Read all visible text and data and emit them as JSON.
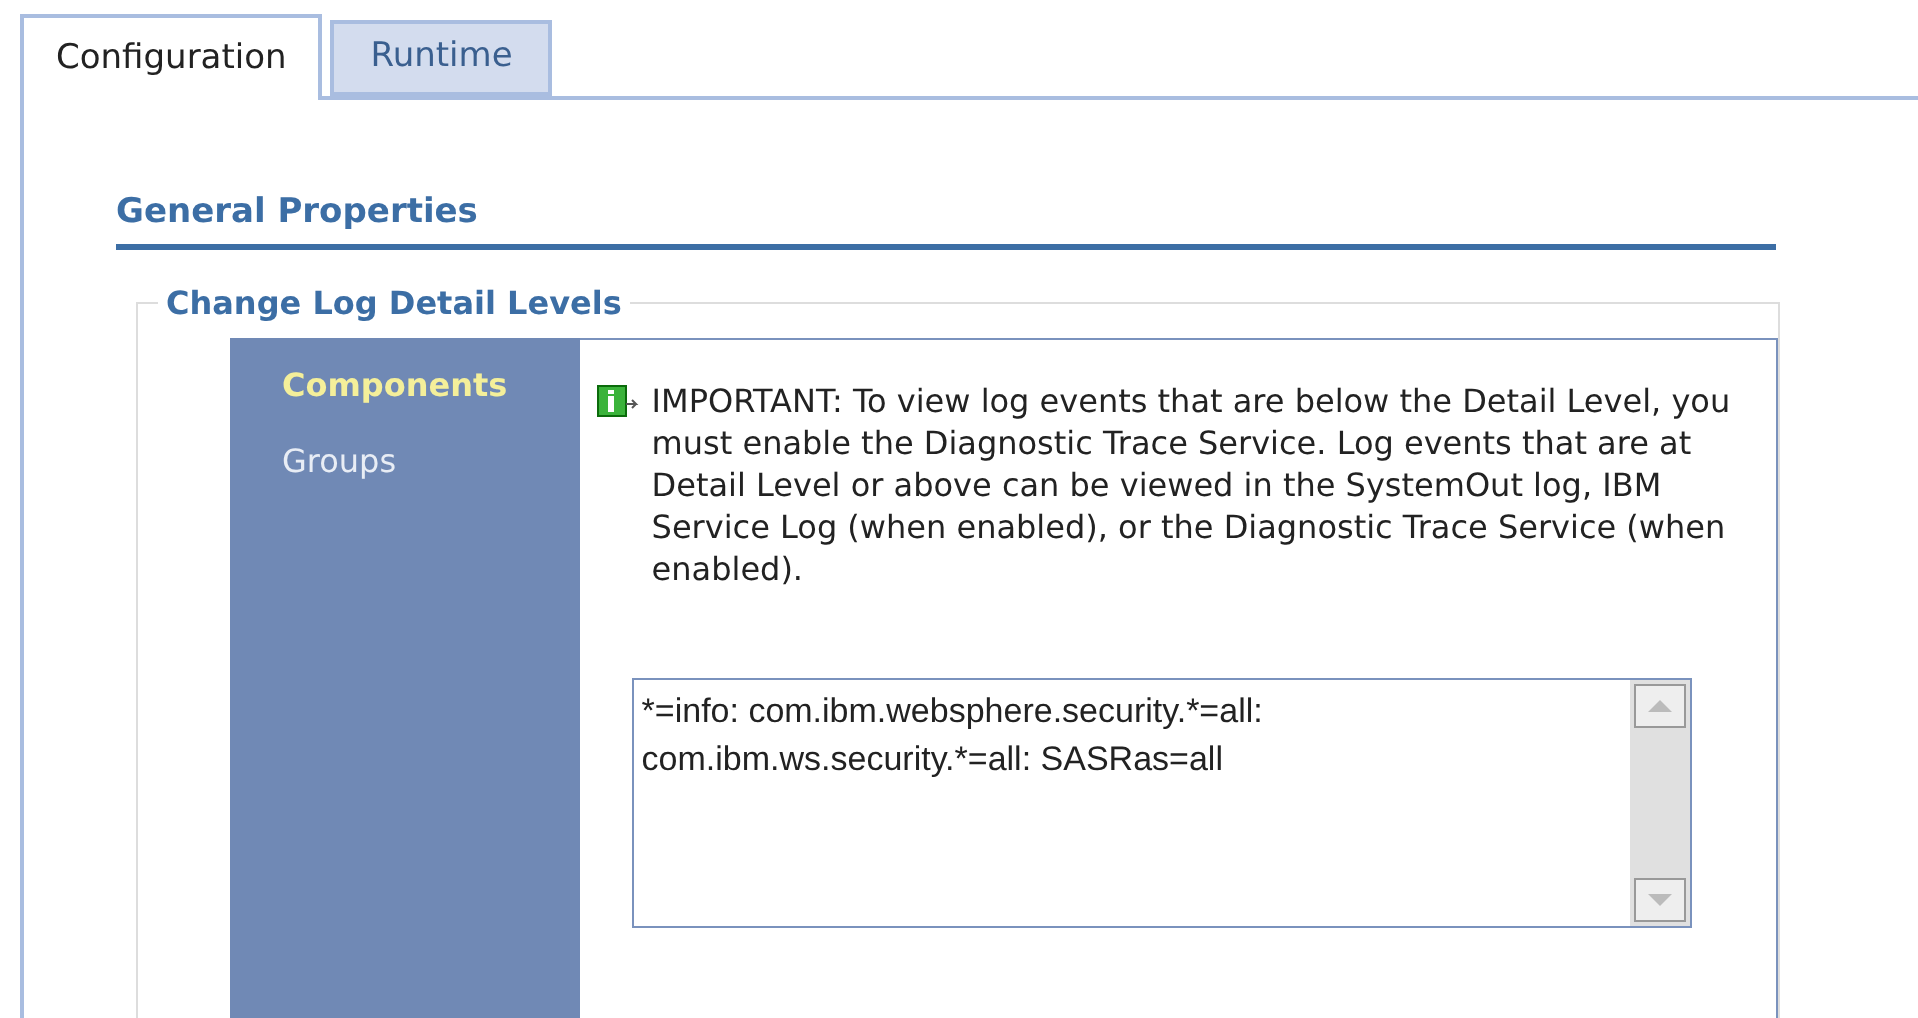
{
  "tabs": [
    {
      "label": "Configuration",
      "selected": true
    },
    {
      "label": "Runtime",
      "selected": false
    }
  ],
  "section_title": "General Properties",
  "fieldset": {
    "legend": "Change Log Detail Levels",
    "nav_items": [
      {
        "label": "Components",
        "selected": true
      },
      {
        "label": "Groups",
        "selected": false
      }
    ],
    "notice": "IMPORTANT: To view log events that are below the Detail Level, you must enable the Diagnostic Trace Service. Log events that are at Detail Level or above can be viewed in the SystemOut log, IBM Service Log (when enabled), or the Diagnostic Trace Service (when enabled).",
    "log_spec": {
      "value": "*=info: com.ibm.websphere.security.*=all: com.ibm.ws.security.*=all: SASRas=all"
    }
  }
}
